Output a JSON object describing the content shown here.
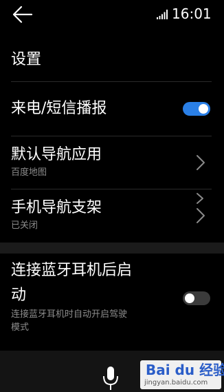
{
  "status_bar": {
    "time": "16:01",
    "signal_icon": "signal-icon"
  },
  "header": {
    "back_icon": "back-arrow-icon",
    "title": "设置"
  },
  "settings": {
    "call_sms_broadcast": {
      "title": "来电/短信播报",
      "toggle_on": true
    },
    "default_nav_app": {
      "title": "默认导航应用",
      "subtitle": "百度地图"
    },
    "phone_nav_mount": {
      "title": "手机导航支架",
      "subtitle": "已关闭"
    },
    "bluetooth_headset_launch": {
      "title_line1": "连接蓝牙耳机后启",
      "title_line2": "动",
      "subtitle_line1": "连接蓝牙耳机时自动开启驾驶",
      "subtitle_line2": "模式",
      "toggle_on": false
    }
  },
  "bottom_bar": {
    "mic_icon": "microphone-icon"
  },
  "watermark": {
    "brand": "Bai du 经验",
    "url": "jingyan.baidu.com"
  },
  "colors": {
    "accent": "#2a7fe6",
    "background": "#000000",
    "subtitle": "#8c8c8c"
  }
}
